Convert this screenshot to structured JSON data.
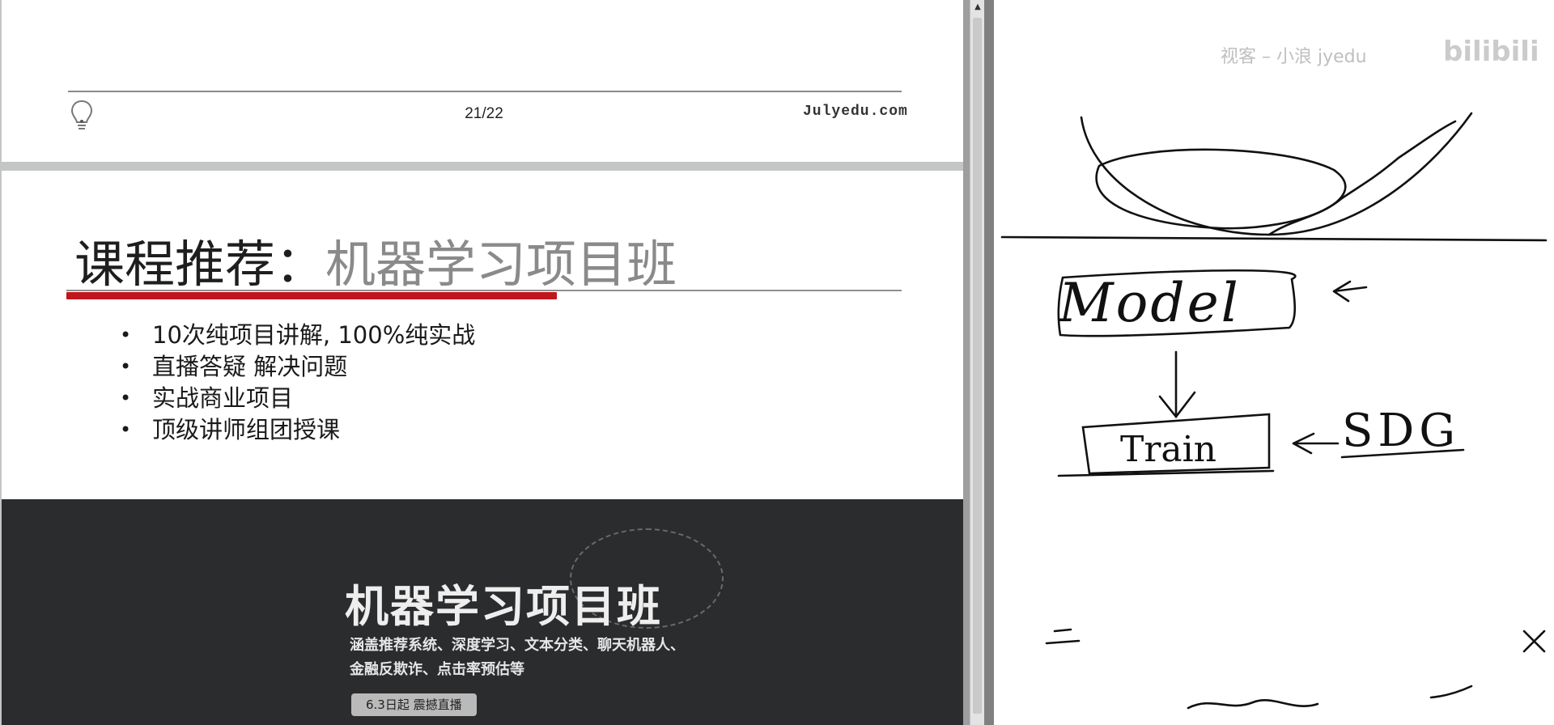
{
  "pdf_viewer": {
    "previous_page": {
      "page_number": "21/22",
      "site": "Julyedu.com"
    },
    "current_page": {
      "title_main": "课程推荐：",
      "title_sub": "机器学习项目班",
      "bullets": [
        "10次纯项目讲解, 100%纯实战",
        "直播答疑 解决问题",
        "实战商业项目",
        "顶级讲师组团授课"
      ],
      "banner": {
        "calligraphy": "机器学习项目班",
        "desc_line1": "涵盖推荐系统、深度学习、文本分类、聊天机器人、",
        "desc_line2": "金融反欺诈、点击率预估等",
        "live_button": "6.3日起 震撼直播"
      }
    }
  },
  "whiteboard": {
    "watermark_text": "视客 – 小浪 jyedu",
    "watermark_logo": "bilibili",
    "labels": {
      "model": "Model",
      "train": "Train",
      "sdg": "SDG"
    }
  }
}
